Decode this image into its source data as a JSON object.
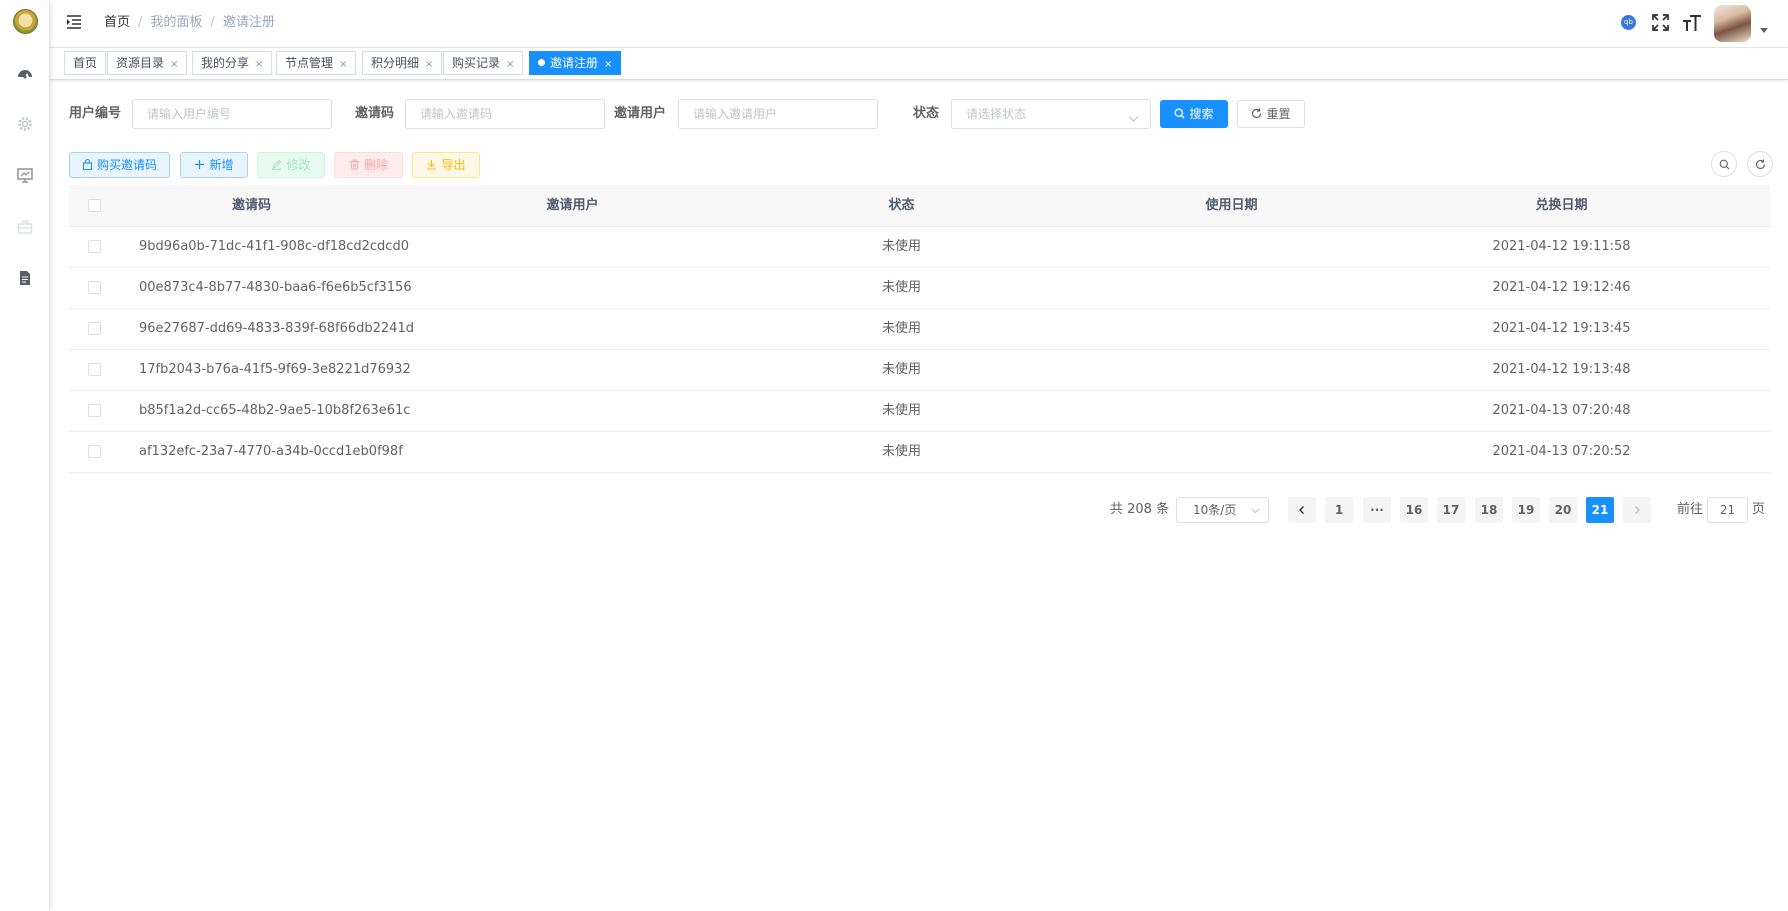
{
  "breadcrumb": {
    "home": "首页",
    "panel": "我的面板",
    "current": "邀请注册"
  },
  "navbar": {
    "badge": "qb"
  },
  "tags": [
    {
      "label": "首页",
      "closable": false
    },
    {
      "label": "资源目录",
      "closable": true
    },
    {
      "label": "我的分享",
      "closable": true
    },
    {
      "label": "节点管理",
      "closable": true
    },
    {
      "label": "积分明细",
      "closable": true
    },
    {
      "label": "购买记录",
      "closable": true
    },
    {
      "label": "邀请注册",
      "closable": true,
      "active": true
    }
  ],
  "tag_close": "×",
  "search": {
    "user_id_label": "用户编号",
    "user_id_placeholder": "请输入用户编号",
    "code_label": "邀请码",
    "code_placeholder": "请输入邀请码",
    "invite_user_label": "邀请用户",
    "invite_user_placeholder": "请输入邀请用户",
    "status_label": "状态",
    "status_placeholder": "请选择状态",
    "search_button": "搜索",
    "reset_button": "重置"
  },
  "toolbar": {
    "buy_label": "购买邀请码",
    "add_label": "新增",
    "edit_label": "修改",
    "delete_label": "删除",
    "export_label": "导出"
  },
  "table": {
    "columns": [
      "邀请码",
      "邀请用户",
      "状态",
      "使用日期",
      "兑换日期"
    ],
    "rows": [
      {
        "code": "9bd96a0b-71dc-41f1-908c-df18cd2cdcd0",
        "user": "",
        "status": "未使用",
        "used": "",
        "redeemed": "2021-04-12 19:11:58"
      },
      {
        "code": "00e873c4-8b77-4830-baa6-f6e6b5cf3156",
        "user": "",
        "status": "未使用",
        "used": "",
        "redeemed": "2021-04-12 19:12:46"
      },
      {
        "code": "96e27687-dd69-4833-839f-68f66db2241d",
        "user": "",
        "status": "未使用",
        "used": "",
        "redeemed": "2021-04-12 19:13:45"
      },
      {
        "code": "17fb2043-b76a-41f5-9f69-3e8221d76932",
        "user": "",
        "status": "未使用",
        "used": "",
        "redeemed": "2021-04-12 19:13:48"
      },
      {
        "code": "b85f1a2d-cc65-48b2-9ae5-10b8f263e61c",
        "user": "",
        "status": "未使用",
        "used": "",
        "redeemed": "2021-04-13 07:20:48"
      },
      {
        "code": "af132efc-23a7-4770-a34b-0ccd1eb0f98f",
        "user": "",
        "status": "未使用",
        "used": "",
        "redeemed": "2021-04-13 07:20:52"
      }
    ]
  },
  "pagination": {
    "total": "共 208 条",
    "page_size": "10条/页",
    "pages": [
      "1",
      "···",
      "16",
      "17",
      "18",
      "19",
      "20",
      "21"
    ],
    "current": "21",
    "goto_label": "前往",
    "goto_value": "21",
    "page_suffix": "页"
  }
}
